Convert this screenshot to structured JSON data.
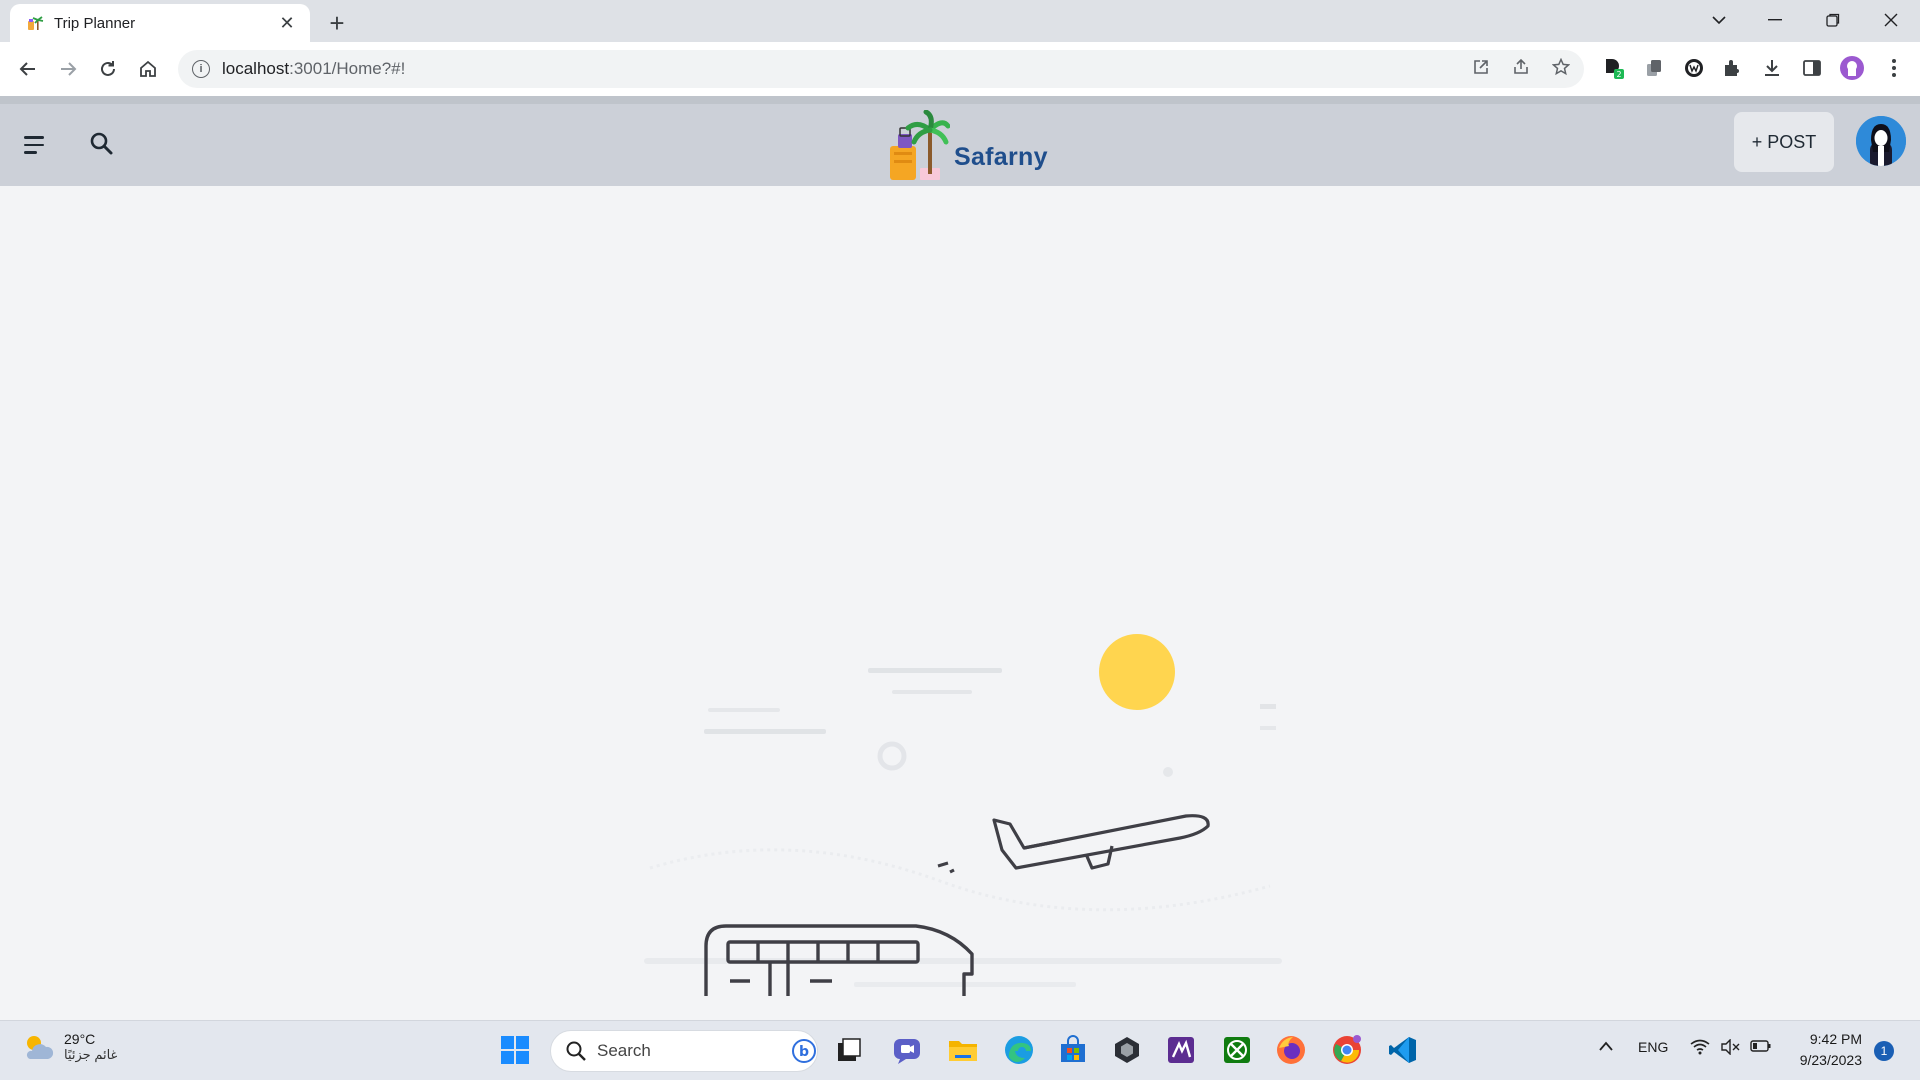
{
  "browser": {
    "tab_title": "Trip Planner",
    "url_host": "localhost",
    "url_path": ":3001/Home?#!",
    "new_tab_symbol": "+",
    "close_symbol": "✕"
  },
  "app": {
    "brand_name": "Safarny",
    "post_button_label": "+ POST",
    "colors": {
      "appbar_bg": "#ccd0d8",
      "brand_text": "#1f4e8c",
      "sun": "#ffd54f",
      "avatar_bg": "#2e8ad9"
    },
    "icons": [
      "menu-icon",
      "search-icon",
      "brand-logo",
      "avatar-icon"
    ]
  },
  "main": {
    "illustration": [
      "sun",
      "airplane",
      "bus",
      "clouds"
    ]
  },
  "taskbar": {
    "weather_temp": "29°C",
    "weather_desc": "غائم جزئيًا",
    "search_placeholder": "Search",
    "language": "ENG",
    "time": "9:42 PM",
    "date": "9/23/2023",
    "notification_count": "1",
    "pinned": [
      "windows-start",
      "search",
      "task-view",
      "teams-chat",
      "file-explorer",
      "edge",
      "microsoft-store",
      "unity",
      "visual-studio",
      "xbox",
      "firefox",
      "chrome",
      "vscode"
    ]
  }
}
